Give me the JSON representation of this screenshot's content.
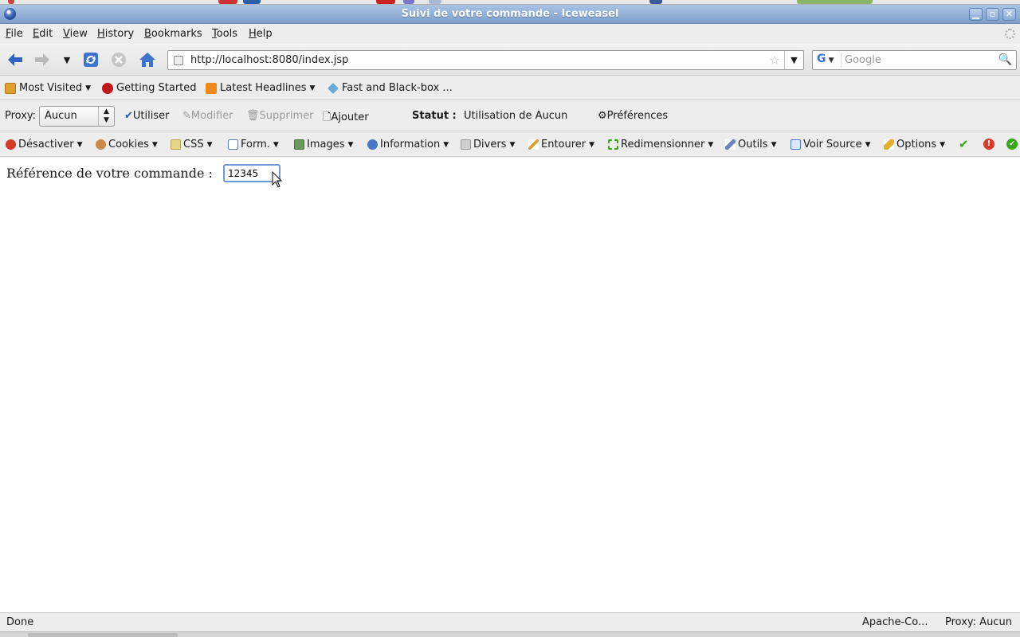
{
  "window": {
    "title": "Suivi de votre commande - Iceweasel",
    "controls": [
      "minimize",
      "maximize",
      "close"
    ]
  },
  "menubar": {
    "items": [
      "File",
      "Edit",
      "View",
      "History",
      "Bookmarks",
      "Tools",
      "Help"
    ]
  },
  "navigation": {
    "url": "http://localhost:8080/index.jsp",
    "search_placeholder": "Google",
    "search_engine": "G"
  },
  "bookmarks": {
    "items": [
      "Most Visited",
      "Getting Started",
      "Latest Headlines",
      "Fast and Black-box ..."
    ]
  },
  "proxy_toolbar": {
    "label": "Proxy:",
    "selected": "Aucun",
    "use": "Utiliser",
    "modify": "Modifier",
    "delete": "Supprimer",
    "add": "Ajouter",
    "status_label": "Statut :",
    "status_value": "Utilisation de Aucun",
    "preferences": "Préférences"
  },
  "dev_toolbar": {
    "items": [
      "Désactiver",
      "Cookies",
      "CSS",
      "Form.",
      "Images",
      "Information",
      "Divers",
      "Entourer",
      "Redimensionner",
      "Outils",
      "Voir Source",
      "Options"
    ]
  },
  "content": {
    "label": "Référence de votre commande :",
    "input_value": "12345"
  },
  "statusbar": {
    "text": "Done",
    "addon": "Apache-Co...",
    "proxy": "Proxy: Aucun"
  },
  "colors": {
    "titlebar": "#8fb0da",
    "focus_ring": "#6f9ad6",
    "back_arrow": "#2f63c7",
    "ok_green": "#3aa61a",
    "error_red": "#d83a2a"
  }
}
